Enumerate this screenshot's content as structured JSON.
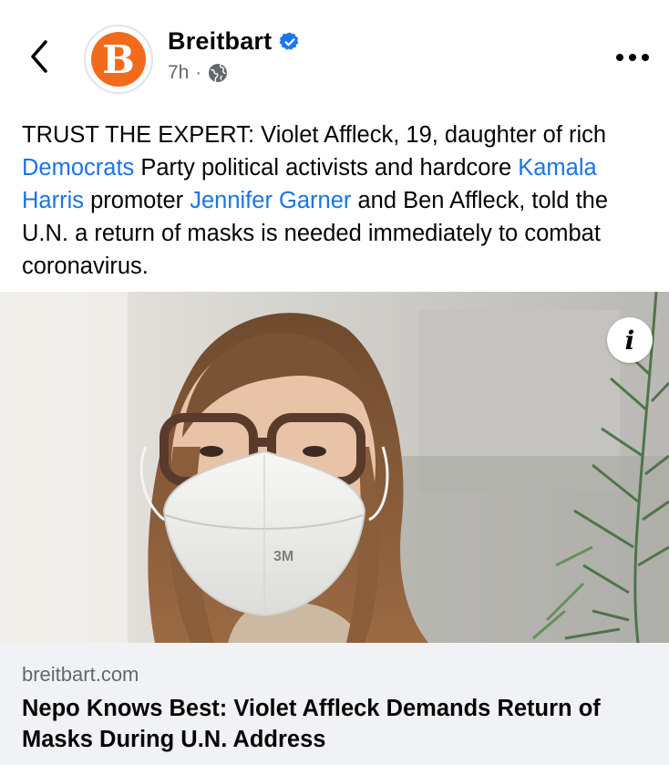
{
  "header": {
    "page_name": "Breitbart",
    "avatar_letter": "B",
    "time": "7h",
    "separator": "·",
    "audience_icon": "globe-icon",
    "verified_icon": "verified-badge-icon",
    "back_icon": "chevron-left-icon",
    "more_icon": "more-horizontal-icon"
  },
  "post": {
    "text_parts": {
      "p1": "TRUST THE EXPERT: Violet Affleck, 19, daughter of rich ",
      "link1": "Democrats",
      "p2": " Party political activists and hardcore ",
      "link2": "Kamala Harris",
      "p3": " promoter ",
      "link3": "Jennifer Garner",
      "p4": " and Ben Affleck, told the U.N. a return of masks is needed immediately to combat coronavirus."
    }
  },
  "photo": {
    "info_label": "i",
    "mask_brand": "3M"
  },
  "link_preview": {
    "domain": "breitbart.com",
    "headline": "Nepo Knows Best: Violet Affleck Demands Return of Masks During U.N. Address"
  },
  "colors": {
    "link": "#1b74e4",
    "brand_orange": "#f26b1d",
    "verified_blue": "#1877f2",
    "secondary_text": "#65676b",
    "preview_bg": "#f0f2f5"
  }
}
